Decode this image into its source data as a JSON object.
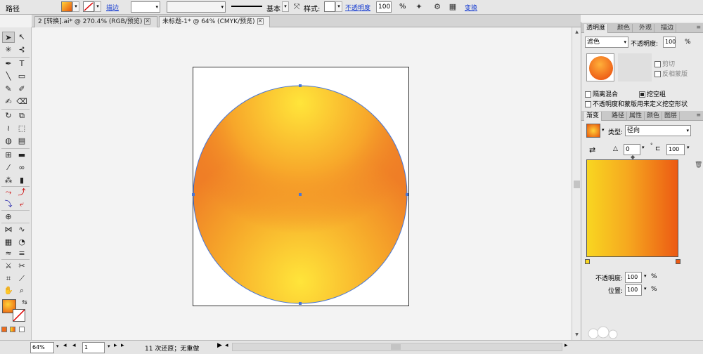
{
  "control_bar": {
    "object_type": "路径",
    "stroke_link": "描边",
    "brush_preset": "基本",
    "style_label": "样式:",
    "opacity_link": "不透明度",
    "opacity_value": "100",
    "opacity_unit": "%",
    "transform_link": "变换"
  },
  "tabs": [
    {
      "label": "2 [转换].ai* @ 270.4% (RGB/预览)"
    },
    {
      "label": "未标题-1* @ 64% (CMYK/预览)"
    }
  ],
  "panel_transparency": {
    "tabs": [
      "透明度",
      "颜色",
      "外观",
      "描边"
    ],
    "blend_mode": "滤色",
    "opacity_label": "不透明度:",
    "opacity_value": "100",
    "opacity_unit": "%",
    "clip_label": "剪切",
    "invert_mask_label": "反相蒙版",
    "isolate_blending_label": "隔离混合",
    "knockout_group_label": "挖空组",
    "opacity_mask_label": "不透明度和蒙版用来定义挖空形状"
  },
  "panel_gradient": {
    "tabs": [
      "渐变",
      "路径",
      "属性",
      "颜色",
      "图层"
    ],
    "type_label": "类型:",
    "type_value": "径向",
    "angle_value": "0",
    "aspect_value": "100",
    "stop_opacity_label": "不透明度:",
    "stop_opacity_value": "100",
    "location_label": "位置:",
    "location_value": "100",
    "percent": "%",
    "colors": {
      "start": "#f8d621",
      "mid": "#f6a81f",
      "end": "#ec5a13"
    }
  },
  "status_bar": {
    "zoom": "64%",
    "page": "1",
    "message": "11 次还原；无重做"
  },
  "colors": {
    "accent_link": "#1a3fd1",
    "selection_blue": "#4a77d6",
    "circle_light": "#ffe53a",
    "circle_dark": "#ee7a25"
  },
  "icons": [
    "selection-tool-icon",
    "direct-selection-tool-icon",
    "magic-wand-icon",
    "lasso-icon",
    "pen-tool-icon",
    "type-tool-icon",
    "line-tool-icon",
    "rectangle-tool-icon",
    "paintbrush-icon",
    "pencil-icon",
    "eraser-icon",
    "rotate-tool-icon",
    "scale-tool-icon",
    "warp-tool-icon",
    "free-transform-icon",
    "shape-builder-icon",
    "perspective-grid-icon",
    "mesh-tool-icon",
    "gradient-tool-icon",
    "eyedropper-icon",
    "blend-tool-icon",
    "symbol-sprayer-icon",
    "graph-tool-icon",
    "artboard-tool-icon",
    "slice-tool-icon",
    "hand-tool-icon",
    "zoom-tool-icon"
  ]
}
